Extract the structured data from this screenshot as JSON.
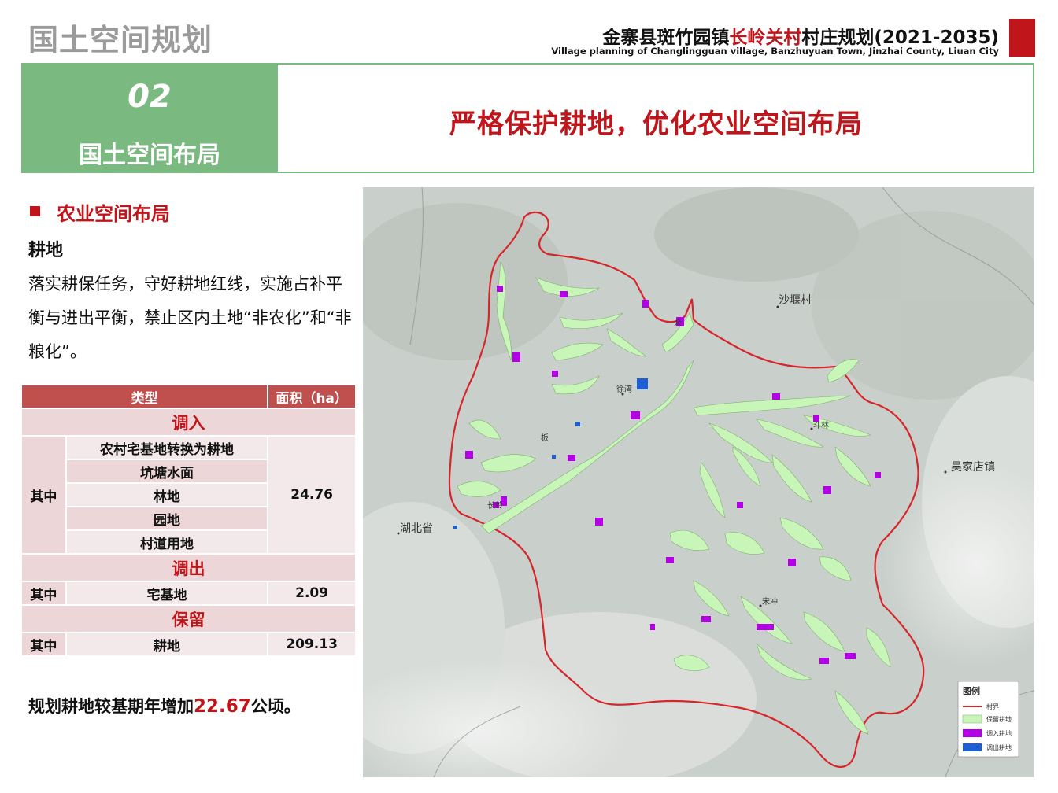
{
  "header": {
    "brand": "国土空间规划",
    "title_prefix": "金寨县斑竹园镇",
    "title_highlight": "长岭关村",
    "title_suffix": "村庄规划(2021-2035)",
    "subtitle": "Village planning of Changlingguan village, Banzhuyuan Town, Jinzhai County, Liuan City"
  },
  "section": {
    "number": "02",
    "name": "国土空间布局",
    "headline": "严格保护耕地，优化农业空间布局"
  },
  "content": {
    "sub_heading": "农业空间布局",
    "item_heading": "耕地",
    "paragraph": "落实耕保任务，守好耕地红线，实施占补平衡与进出平衡，禁止区内土地“非农化”和“非粮化”。",
    "summary_prefix": "规划耕地较基期年增加",
    "summary_value": "22.67",
    "summary_suffix": "公顷。"
  },
  "table": {
    "headers": [
      "类型",
      "面积（ha）"
    ],
    "group_in": "调入",
    "among_label": "其中",
    "in_items": [
      "农村宅基地转换为耕地",
      "坑塘水面",
      "林地",
      "园地",
      "村道用地"
    ],
    "in_value": "24.76",
    "group_out": "调出",
    "out_item": "宅基地",
    "out_value": "2.09",
    "group_keep": "保留",
    "keep_item": "耕地",
    "keep_value": "209.13"
  },
  "map": {
    "places": [
      "沙堰村",
      "斗林",
      "徐湾",
      "板",
      "长岭",
      "吴家店镇",
      "湖北省",
      "宋冲",
      "余"
    ],
    "legend": {
      "title": "图例",
      "items": [
        {
          "label": "村界",
          "color": "#d7262b"
        },
        {
          "label": "保留耕地",
          "color": "#c8f5b8"
        },
        {
          "label": "调入耕地",
          "color": "#b300e6"
        },
        {
          "label": "调出耕地",
          "color": "#1c5fd4"
        }
      ]
    }
  }
}
